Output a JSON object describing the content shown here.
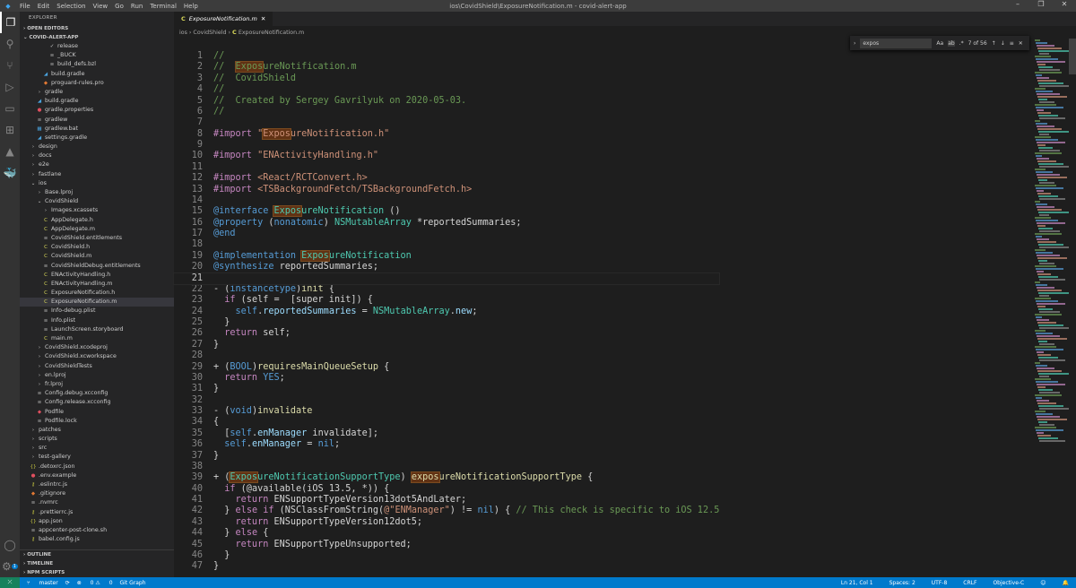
{
  "titlebar": {
    "menu": [
      "File",
      "Edit",
      "Selection",
      "View",
      "Go",
      "Run",
      "Terminal",
      "Help"
    ],
    "title": "ios\\CovidShield\\ExposureNotification.m - covid-alert-app"
  },
  "sidebar": {
    "title": "EXPLORER",
    "open_editors": "OPEN EDITORS",
    "root": "COVID-ALERT-APP",
    "outline": "OUTLINE",
    "timeline": "TIMELINE",
    "npm": "NPM SCRIPTS",
    "items": [
      {
        "label": "release",
        "lvl": 4,
        "icon": "chevron-down"
      },
      {
        "label": "_BUCK",
        "lvl": 4,
        "icon": "file"
      },
      {
        "label": "build_defs.bzl",
        "lvl": 4,
        "icon": "file"
      },
      {
        "label": "build.gradle",
        "lvl": 3,
        "icon": "gradle"
      },
      {
        "label": "proguard-rules.pro",
        "lvl": 3,
        "icon": "pro"
      },
      {
        "label": "gradle",
        "lvl": 2,
        "icon": "folder"
      },
      {
        "label": "build.gradle",
        "lvl": 2,
        "icon": "gradle"
      },
      {
        "label": "gradle.properties",
        "lvl": 2,
        "icon": "gear"
      },
      {
        "label": "gradlew",
        "lvl": 2,
        "icon": "file"
      },
      {
        "label": "gradlew.bat",
        "lvl": 2,
        "icon": "windows"
      },
      {
        "label": "settings.gradle",
        "lvl": 2,
        "icon": "gradle"
      },
      {
        "label": "design",
        "lvl": 1,
        "icon": "folder"
      },
      {
        "label": "docs",
        "lvl": 1,
        "icon": "folder"
      },
      {
        "label": "e2e",
        "lvl": 1,
        "icon": "folder"
      },
      {
        "label": "fastlane",
        "lvl": 1,
        "icon": "folder"
      },
      {
        "label": "ios",
        "lvl": 1,
        "icon": "folder-open"
      },
      {
        "label": "Base.lproj",
        "lvl": 2,
        "icon": "folder"
      },
      {
        "label": "CovidShield",
        "lvl": 2,
        "icon": "folder-open"
      },
      {
        "label": "Images.xcassets",
        "lvl": 3,
        "icon": "folder"
      },
      {
        "label": "AppDelegate.h",
        "lvl": 3,
        "icon": "c"
      },
      {
        "label": "AppDelegate.m",
        "lvl": 3,
        "icon": "c"
      },
      {
        "label": "CovidShield.entitlements",
        "lvl": 3,
        "icon": "file"
      },
      {
        "label": "CovidShield.h",
        "lvl": 3,
        "icon": "c"
      },
      {
        "label": "CovidShield.m",
        "lvl": 3,
        "icon": "c"
      },
      {
        "label": "CovidShieldDebug.entitlements",
        "lvl": 3,
        "icon": "file"
      },
      {
        "label": "ENActivityHandling.h",
        "lvl": 3,
        "icon": "c"
      },
      {
        "label": "ENActivityHandling.m",
        "lvl": 3,
        "icon": "c"
      },
      {
        "label": "ExposureNotification.h",
        "lvl": 3,
        "icon": "c"
      },
      {
        "label": "ExposureNotification.m",
        "lvl": 3,
        "icon": "c",
        "selected": true
      },
      {
        "label": "Info-debug.plist",
        "lvl": 3,
        "icon": "file"
      },
      {
        "label": "Info.plist",
        "lvl": 3,
        "icon": "file"
      },
      {
        "label": "LaunchScreen.storyboard",
        "lvl": 3,
        "icon": "file"
      },
      {
        "label": "main.m",
        "lvl": 3,
        "icon": "c"
      },
      {
        "label": "CovidShield.xcodeproj",
        "lvl": 2,
        "icon": "folder"
      },
      {
        "label": "CovidShield.xcworkspace",
        "lvl": 2,
        "icon": "folder"
      },
      {
        "label": "CovidShieldTests",
        "lvl": 2,
        "icon": "folder"
      },
      {
        "label": "en.lproj",
        "lvl": 2,
        "icon": "folder"
      },
      {
        "label": "fr.lproj",
        "lvl": 2,
        "icon": "folder"
      },
      {
        "label": "Config.debug.xcconfig",
        "lvl": 2,
        "icon": "file"
      },
      {
        "label": "Config.release.xcconfig",
        "lvl": 2,
        "icon": "file"
      },
      {
        "label": "Podfile",
        "lvl": 2,
        "icon": "ruby"
      },
      {
        "label": "Podfile.lock",
        "lvl": 2,
        "icon": "file"
      },
      {
        "label": "patches",
        "lvl": 1,
        "icon": "folder"
      },
      {
        "label": "scripts",
        "lvl": 1,
        "icon": "folder"
      },
      {
        "label": "src",
        "lvl": 1,
        "icon": "folder"
      },
      {
        "label": "test-gallery",
        "lvl": 1,
        "icon": "folder"
      },
      {
        "label": ".detoxrc.json",
        "lvl": 1,
        "icon": "json"
      },
      {
        "label": ".env.example",
        "lvl": 1,
        "icon": "gear"
      },
      {
        "label": ".eslintrc.js",
        "lvl": 1,
        "icon": "js"
      },
      {
        "label": ".gitignore",
        "lvl": 1,
        "icon": "git"
      },
      {
        "label": ".nvmrc",
        "lvl": 1,
        "icon": "file"
      },
      {
        "label": ".prettierrc.js",
        "lvl": 1,
        "icon": "js"
      },
      {
        "label": "app.json",
        "lvl": 1,
        "icon": "json"
      },
      {
        "label": "appcenter-post-clone.sh",
        "lvl": 1,
        "icon": "file"
      },
      {
        "label": "babel.config.js",
        "lvl": 1,
        "icon": "js"
      }
    ]
  },
  "editor": {
    "tab": "ExposureNotification.m",
    "breadcrumb": [
      "ios",
      "CovidShield",
      "ExposureNotification.m"
    ],
    "find": {
      "query": "expos",
      "count": "7 of 56",
      "case": "Aa",
      "word": "ab"
    },
    "current_line": 21,
    "lines": [
      [
        [
          "//",
          "c"
        ]
      ],
      [
        [
          "//  ",
          "c"
        ],
        [
          "Expos",
          "cm"
        ],
        [
          "ureNotification.m",
          "c"
        ]
      ],
      [
        [
          "//  CovidShield",
          "c"
        ]
      ],
      [
        [
          "//",
          "c"
        ]
      ],
      [
        [
          "//  Created by Sergey Gavrilyuk on 2020-05-03.",
          "c"
        ]
      ],
      [
        [
          "//",
          "c"
        ]
      ],
      [],
      [
        [
          "#import ",
          "p"
        ],
        [
          "\"",
          "s"
        ],
        [
          "Expos",
          "sm"
        ],
        [
          "ureNotification.h\"",
          "s"
        ]
      ],
      [],
      [
        [
          "#import ",
          "p"
        ],
        [
          "\"ENActivityHandling.h\"",
          "s"
        ]
      ],
      [],
      [
        [
          "#import ",
          "p"
        ],
        [
          "<React/RCTConvert.h>",
          "s"
        ]
      ],
      [
        [
          "#import ",
          "p"
        ],
        [
          "<TSBackgroundFetch/TSBackgroundFetch.h>",
          "s"
        ]
      ],
      [],
      [
        [
          "@interface ",
          "k"
        ],
        [
          "Expos",
          "tm"
        ],
        [
          "ureNotification",
          "t"
        ],
        [
          " ()",
          "d"
        ]
      ],
      [
        [
          "@property ",
          "k"
        ],
        [
          "(",
          "d"
        ],
        [
          "nonatomic",
          "k"
        ],
        [
          ") ",
          "d"
        ],
        [
          "NSMutableArray",
          "t"
        ],
        [
          " *reportedSummaries;",
          "d"
        ]
      ],
      [
        [
          "@end",
          "k"
        ]
      ],
      [],
      [
        [
          "@implementation ",
          "k"
        ],
        [
          "Expos",
          "tm"
        ],
        [
          "ureNotification",
          "t"
        ]
      ],
      [
        [
          "@synthesize ",
          "k"
        ],
        [
          "reportedSummaries;",
          "d"
        ]
      ],
      [],
      [
        [
          "- (",
          "d"
        ],
        [
          "instancetype",
          "k"
        ],
        [
          ")",
          "d"
        ],
        [
          "init",
          "f"
        ],
        [
          " {",
          "d"
        ]
      ],
      [
        [
          "  if ",
          "p"
        ],
        [
          "(self =  [super init]) {",
          "d"
        ]
      ],
      [
        [
          "    self",
          "k"
        ],
        [
          ".",
          "d"
        ],
        [
          "reportedSummaries",
          "v"
        ],
        [
          " = ",
          "d"
        ],
        [
          "NSMutableArray",
          "t"
        ],
        [
          ".",
          "d"
        ],
        [
          "new",
          "v"
        ],
        [
          ";",
          "d"
        ]
      ],
      [
        [
          "  }",
          "d"
        ]
      ],
      [
        [
          "  return ",
          "p"
        ],
        [
          "self;",
          "d"
        ]
      ],
      [
        [
          "}",
          "d"
        ]
      ],
      [],
      [
        [
          "+ (",
          "d"
        ],
        [
          "BOOL",
          "k"
        ],
        [
          ")",
          "d"
        ],
        [
          "requiresMainQueueSetup",
          "f"
        ],
        [
          " {",
          "d"
        ]
      ],
      [
        [
          "  return ",
          "p"
        ],
        [
          "YES",
          "k"
        ],
        [
          ";",
          "d"
        ]
      ],
      [
        [
          "}",
          "d"
        ]
      ],
      [],
      [
        [
          "- (",
          "d"
        ],
        [
          "void",
          "k"
        ],
        [
          ")",
          "d"
        ],
        [
          "invalidate",
          "f"
        ]
      ],
      [
        [
          "{",
          "d"
        ]
      ],
      [
        [
          "  [",
          "d"
        ],
        [
          "self",
          "k"
        ],
        [
          ".",
          "d"
        ],
        [
          "enManager",
          "v"
        ],
        [
          " invalidate];",
          "d"
        ]
      ],
      [
        [
          "  self",
          "k"
        ],
        [
          ".",
          "d"
        ],
        [
          "enManager",
          "v"
        ],
        [
          " = ",
          "d"
        ],
        [
          "nil",
          "k"
        ],
        [
          ";",
          "d"
        ]
      ],
      [
        [
          "}",
          "d"
        ]
      ],
      [],
      [
        [
          "+ (",
          "d"
        ],
        [
          "Expos",
          "tm"
        ],
        [
          "ureNotificationSupportType",
          "t"
        ],
        [
          ") ",
          "d"
        ],
        [
          "expos",
          "fm"
        ],
        [
          "ureNotificationSupportType",
          "f"
        ],
        [
          " {",
          "d"
        ]
      ],
      [
        [
          "  if ",
          "p"
        ],
        [
          "(@available(iOS ",
          "d"
        ],
        [
          "13.5",
          "d"
        ],
        [
          ", *)) {",
          "d"
        ]
      ],
      [
        [
          "    return ",
          "p"
        ],
        [
          "ENSupportTypeVersion13dot5AndLater;",
          "d"
        ]
      ],
      [
        [
          "  } ",
          "d"
        ],
        [
          "else if ",
          "p"
        ],
        [
          "(NSClassFromString(",
          "d"
        ],
        [
          "@\"ENManager\"",
          "s"
        ],
        [
          ") != ",
          "d"
        ],
        [
          "nil",
          "k"
        ],
        [
          ") { ",
          "d"
        ],
        [
          "// This check is specific to iOS 12.5",
          "c"
        ]
      ],
      [
        [
          "    return ",
          "p"
        ],
        [
          "ENSupportTypeVersion12dot5;",
          "d"
        ]
      ],
      [
        [
          "  } ",
          "d"
        ],
        [
          "else ",
          "p"
        ],
        [
          "{",
          "d"
        ]
      ],
      [
        [
          "    return ",
          "p"
        ],
        [
          "ENSupportTypeUnsupported;",
          "d"
        ]
      ],
      [
        [
          "  }",
          "d"
        ]
      ],
      [
        [
          "}",
          "d"
        ]
      ]
    ]
  },
  "status": {
    "branch": "master",
    "errors": "0",
    "warnings": "0",
    "git_graph": "Git Graph",
    "position": "Ln 21, Col 1",
    "spaces": "Spaces: 2",
    "encoding": "UTF-8",
    "eol": "CRLF",
    "language": "Objective-C",
    "badge": "1"
  }
}
